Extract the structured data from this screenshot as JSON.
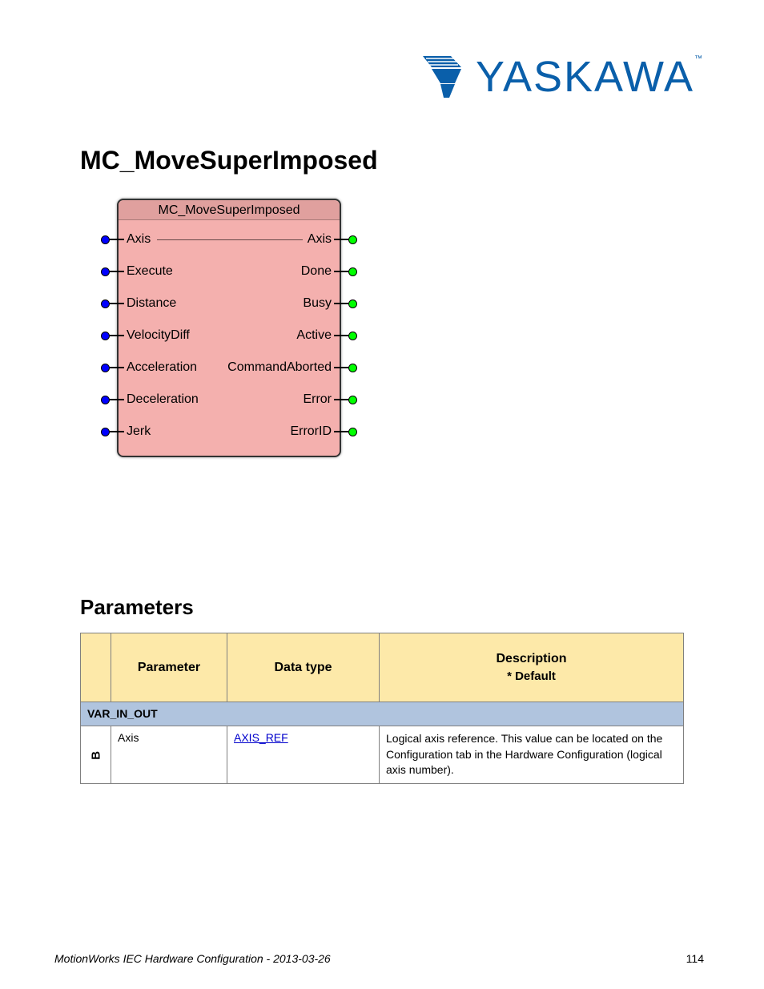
{
  "brand": "YASKAWA",
  "page_title": "MC_MoveSuperImposed",
  "function_block": {
    "title": "MC_MoveSuperImposed",
    "inputs": [
      "Axis",
      "Execute",
      "Distance",
      "VelocityDiff",
      "Acceleration",
      "Deceleration",
      "Jerk"
    ],
    "outputs": [
      "Axis",
      "Done",
      "Busy",
      "Active",
      "CommandAborted",
      "Error",
      "ErrorID"
    ]
  },
  "parameters_heading": "Parameters",
  "table": {
    "headers": {
      "io": "",
      "parameter": "Parameter",
      "data_type": "Data type",
      "description": "Description",
      "default_note": "* Default"
    },
    "var_in_out_label": "VAR_IN_OUT",
    "io_label": "B",
    "row": {
      "parameter": "Axis",
      "data_type": "AXIS_REF",
      "description": "Logical axis reference. This value can be located on the Configuration tab in the Hardware Configuration (logical axis number)."
    }
  },
  "footer": {
    "brand": "MotionWorks IEC Hardware Configuration - 2013-03-26",
    "page": "114"
  }
}
